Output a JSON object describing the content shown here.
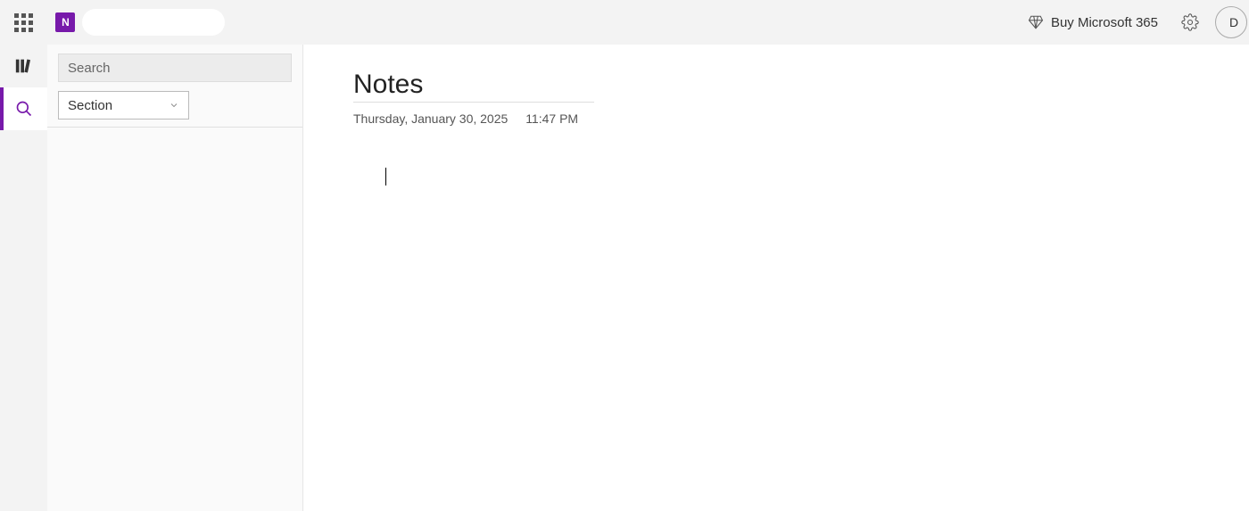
{
  "header": {
    "app_logo_letter": "N",
    "buy_label": "Buy Microsoft 365",
    "avatar_initial": "D"
  },
  "search_panel": {
    "search_placeholder": "Search",
    "scope_selected": "Section"
  },
  "page": {
    "title": "Notes",
    "date": "Thursday, January 30, 2025",
    "time": "11:47 PM"
  },
  "icons": {
    "library": "library-icon",
    "search": "search-icon",
    "diamond": "diamond-icon",
    "gear": "gear-icon",
    "chevron": "chevron-down-icon",
    "waffle": "waffle-icon"
  }
}
